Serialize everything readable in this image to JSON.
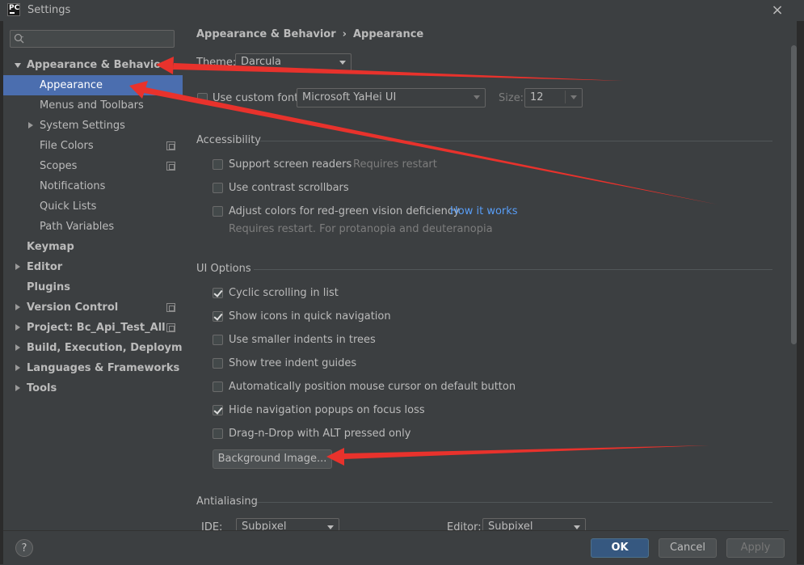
{
  "window": {
    "title": "Settings",
    "close": "×",
    "app_icon": "PC"
  },
  "search": {
    "value": "",
    "placeholder": ""
  },
  "sidebar": {
    "items": [
      {
        "label": "Appearance & Behavior"
      },
      {
        "label": "Appearance"
      },
      {
        "label": "Menus and Toolbars"
      },
      {
        "label": "System Settings"
      },
      {
        "label": "File Colors"
      },
      {
        "label": "Scopes"
      },
      {
        "label": "Notifications"
      },
      {
        "label": "Quick Lists"
      },
      {
        "label": "Path Variables"
      },
      {
        "label": "Keymap"
      },
      {
        "label": "Editor"
      },
      {
        "label": "Plugins"
      },
      {
        "label": "Version Control"
      },
      {
        "label": "Project: Bc_Api_Test_All"
      },
      {
        "label": "Build, Execution, Deployment"
      },
      {
        "label": "Languages & Frameworks"
      },
      {
        "label": "Tools"
      }
    ]
  },
  "breadcrumb": {
    "parent": "Appearance & Behavior",
    "sep": "›",
    "current": "Appearance"
  },
  "theme": {
    "label": "Theme:",
    "value": "Darcula"
  },
  "font": {
    "label": "Use custom font:",
    "value": "Microsoft YaHei UI",
    "size_label": "Size:",
    "size_value": "12"
  },
  "accessibility": {
    "title": "Accessibility",
    "screen_readers": "Support screen readers",
    "requires_restart": "Requires restart",
    "contrast_scrollbars": "Use contrast scrollbars",
    "adjust_colors": "Adjust colors for red-green vision deficiency",
    "how_it_works": "How it works",
    "restart_note": "Requires restart. For protanopia and deuteranopia"
  },
  "ui_options": {
    "title": "UI Options",
    "items": [
      {
        "label": "Cyclic scrolling in list",
        "checked": true
      },
      {
        "label": "Show icons in quick navigation",
        "checked": true
      },
      {
        "label": "Use smaller indents in trees",
        "checked": false
      },
      {
        "label": "Show tree indent guides",
        "checked": false
      },
      {
        "label": "Automatically position mouse cursor on default button",
        "checked": false
      },
      {
        "label": "Hide navigation popups on focus loss",
        "checked": true
      },
      {
        "label": "Drag-n-Drop with ALT pressed only",
        "checked": false
      }
    ],
    "background_image_button": "Background Image..."
  },
  "antialiasing": {
    "title": "Antialiasing",
    "ide_label": "IDE:",
    "ide_value": "Subpixel",
    "editor_label": "Editor:",
    "editor_value": "Subpixel"
  },
  "footer": {
    "help": "?",
    "ok": "OK",
    "cancel": "Cancel",
    "apply": "Apply"
  },
  "colors": {
    "background": "#3c3f41",
    "selection": "#4b6eaf",
    "link": "#589df6",
    "primary_button": "#365880",
    "annotation_arrow": "#e8322c"
  }
}
